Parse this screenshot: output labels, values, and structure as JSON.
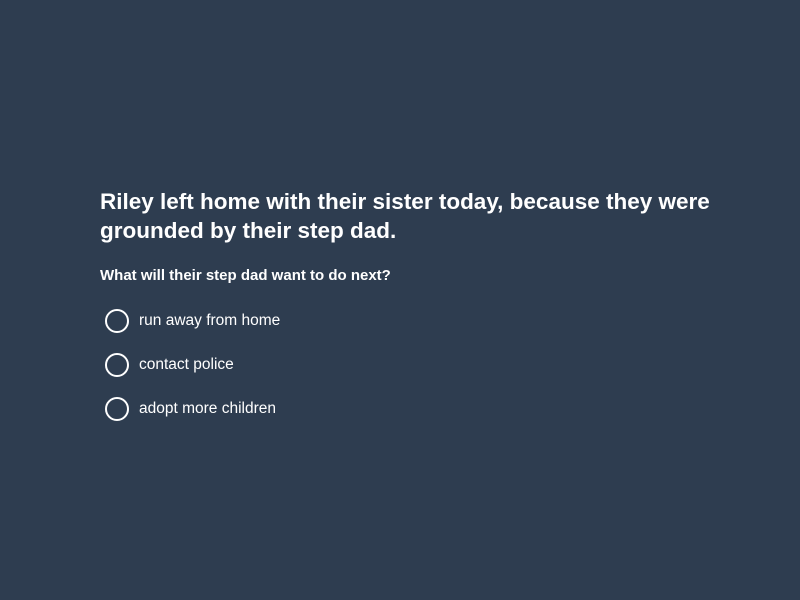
{
  "question": {
    "title": "Riley left home with their sister today, because they were grounded by their step dad.",
    "prompt": "What will their step dad want to do next?",
    "options": [
      {
        "label": "run away from home",
        "selected": false
      },
      {
        "label": "contact police",
        "selected": false
      },
      {
        "label": "adopt more children",
        "selected": false
      }
    ]
  },
  "colors": {
    "background": "#2e3d50",
    "text": "#ffffff"
  }
}
